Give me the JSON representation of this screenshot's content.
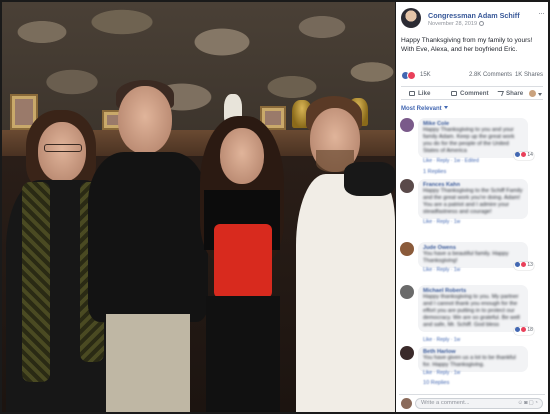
{
  "post": {
    "page_name": "Congressman Adam Schiff",
    "date": "November 28, 2019",
    "text": "Happy Thanksgiving from my family to yours! With Eve, Alexa, and her boyfriend Eric.",
    "reaction_count": "15K",
    "comments_count": "2.8K Comments",
    "shares_count": "1K Shares"
  },
  "actions": {
    "like_label": "Like",
    "comment_label": "Comment",
    "share_label": "Share"
  },
  "sort": {
    "label": "Most Relevant"
  },
  "comments": [
    {
      "name": "Mike Cole",
      "text": "Happy Thanksgiving to you and your family Adam. Keep up the great work you do for the people of the United States of America",
      "meta": "Like · Reply · 1w · Edited",
      "reactions": "14",
      "replies": "1 Replies"
    },
    {
      "name": "Frances Kahn",
      "text": "Happy Thanksgiving to the Schiff Family and the great work you're doing. Adam! You are a patriot and I admire your steadfastness and courage!",
      "meta": "Like · Reply · 1w",
      "reactions": "",
      "replies": ""
    },
    {
      "name": "Jude Owens",
      "text": "You have a beautiful family. Happy Thanksgiving!",
      "meta": "Like · Reply · 1w",
      "reactions": "13",
      "replies": ""
    },
    {
      "name": "Michael Roberts",
      "text": "Happy thanksgiving to you. My partner and I cannot thank you enough for the effort you are putting in to protect our democracy. We are so grateful. Be well and safe, Mr. Schiff. God bless",
      "meta": "Like · Reply · 1w",
      "reactions": "18",
      "replies": ""
    },
    {
      "name": "Beth Harlow",
      "text": "You have given us a lot to be thankful for. Happy Thanksgiving.",
      "meta": "Like · Reply · 1w",
      "reactions": "",
      "replies": "10 Replies"
    }
  ],
  "composer": {
    "placeholder": "Write a comment..."
  },
  "colors": {
    "link_blue": "#385898",
    "fb_blue": "#4267b2",
    "bubble_gray": "#f2f3f5",
    "text_gray": "#606770"
  }
}
